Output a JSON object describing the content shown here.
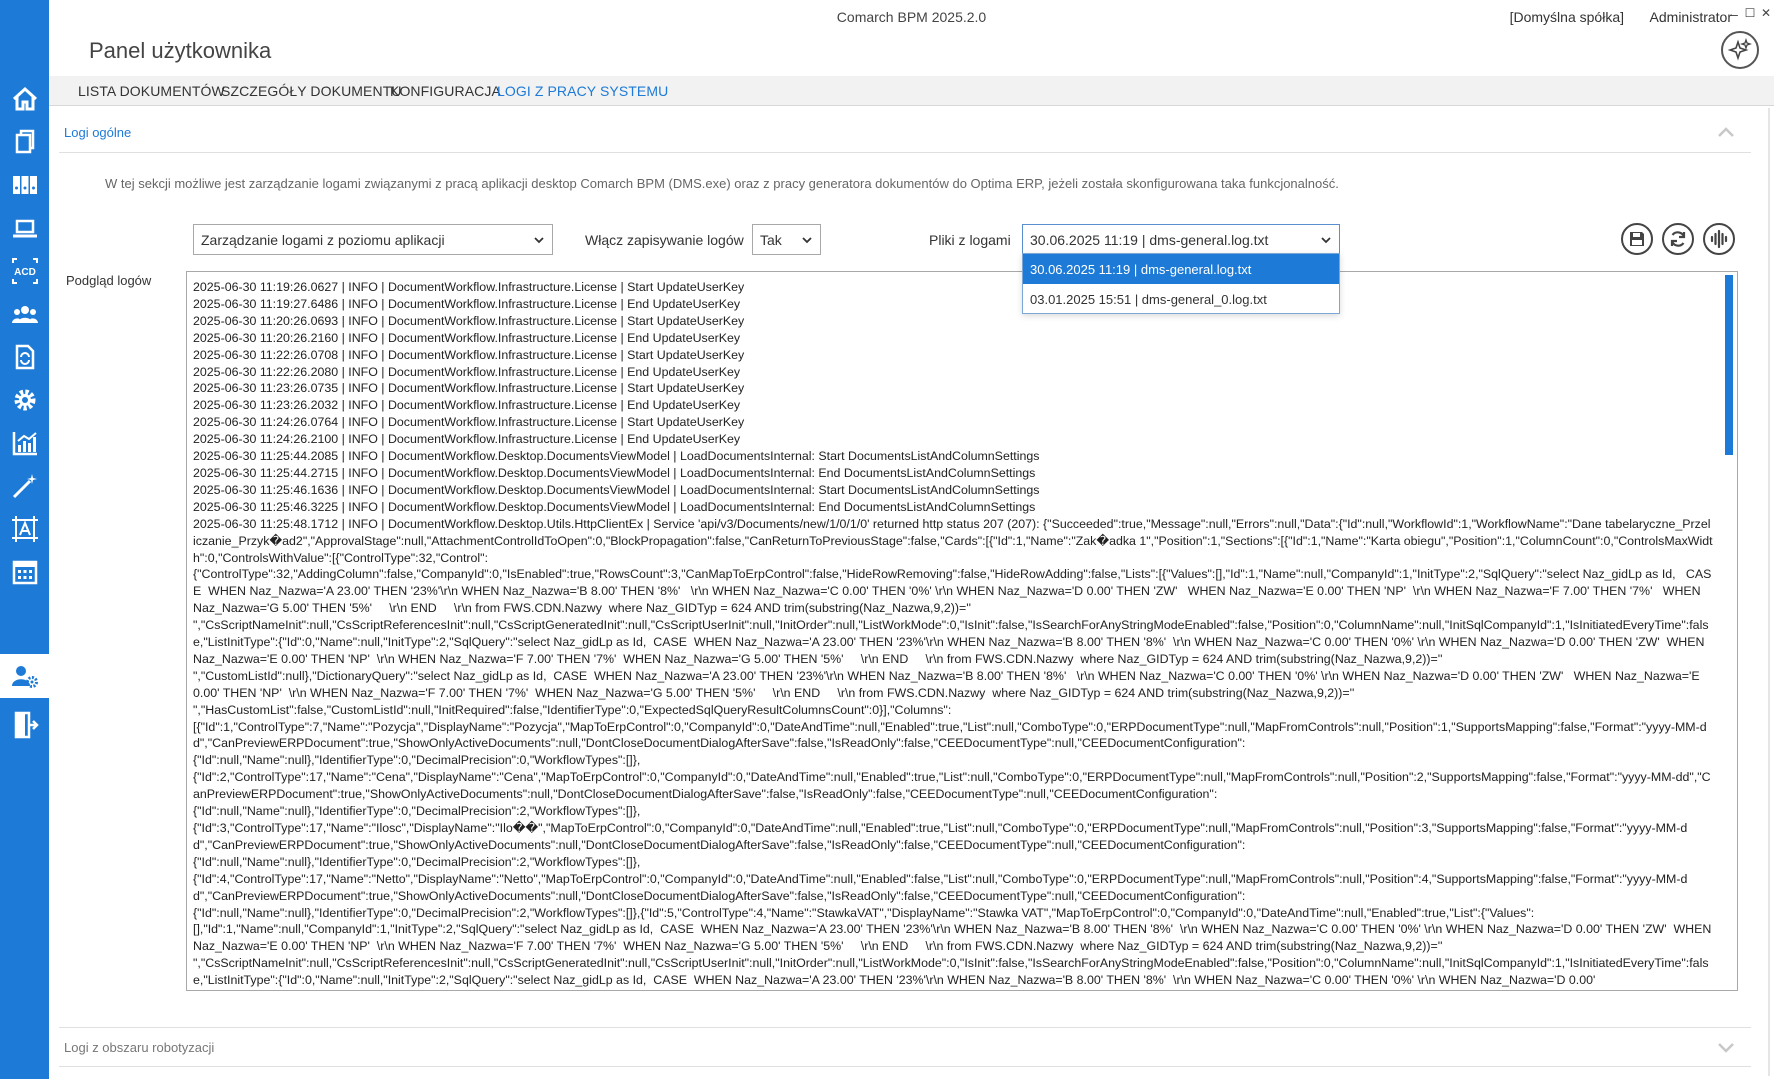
{
  "app": {
    "title": "Comarch BPM 2025.2.0",
    "company": "[Domyślna spółka]",
    "user": "Administrator",
    "page_title": "Panel użytkownika",
    "window_controls": {
      "minimize": "–",
      "maximize": "☐",
      "close": "✕"
    }
  },
  "rail": {
    "items": [
      {
        "icon": "home-icon"
      },
      {
        "icon": "documents-icon"
      },
      {
        "icon": "binders-icon"
      },
      {
        "icon": "laptop-icon"
      },
      {
        "icon": "acd-icon",
        "label": "ACD"
      },
      {
        "icon": "users-icon"
      },
      {
        "icon": "document-sync-icon"
      },
      {
        "icon": "gear-icon"
      },
      {
        "icon": "chart-icon"
      },
      {
        "icon": "magic-wand-icon"
      },
      {
        "icon": "text-frame-icon"
      },
      {
        "icon": "calendar-icon"
      },
      {
        "icon": "user-settings-icon",
        "active": true
      },
      {
        "icon": "logout-icon"
      }
    ]
  },
  "tabs": [
    {
      "label": "LISTA DOKUMENTÓW"
    },
    {
      "label": "SZCZEGÓŁY DOKUMENTU"
    },
    {
      "label": "KONFIGURACJA"
    },
    {
      "label": "LOGI Z PRACY SYSTEMU",
      "active": true
    }
  ],
  "general_logs": {
    "header": "Logi ogólne",
    "description": "W tej sekcji możliwe jest zarządzanie logami związanymi z pracą aplikacji desktop Comarch BPM (DMS.exe) oraz z pracy generatora dokumentów do Optima ERP, jeżeli została skonfigurowana taka funkcjonalność.",
    "mode_select": "Zarządzanie logami z poziomu aplikacji",
    "enable_label": "Włącz zapisywanie logów",
    "enable_value": "Tak",
    "files_label": "Pliki z logami",
    "files_value": "30.06.2025 11:19 | dms-general.log.txt",
    "files_options": [
      "30.06.2025 11:19 | dms-general.log.txt",
      "03.01.2025 15:51 | dms-general_0.log.txt"
    ],
    "preview_label": "Podgląd logów",
    "log_lines": [
      "2025-06-30 11:19:26.0627 | INFO | DocumentWorkflow.Infrastructure.License | Start UpdateUserKey",
      "2025-06-30 11:19:27.6486 | INFO | DocumentWorkflow.Infrastructure.License | End UpdateUserKey",
      "2025-06-30 11:20:26.0693 | INFO | DocumentWorkflow.Infrastructure.License | Start UpdateUserKey",
      "2025-06-30 11:20:26.2160 | INFO | DocumentWorkflow.Infrastructure.License | End UpdateUserKey",
      "2025-06-30 11:22:26.0708 | INFO | DocumentWorkflow.Infrastructure.License | Start UpdateUserKey",
      "2025-06-30 11:22:26.2080 | INFO | DocumentWorkflow.Infrastructure.License | End UpdateUserKey",
      "2025-06-30 11:23:26.0735 | INFO | DocumentWorkflow.Infrastructure.License | Start UpdateUserKey",
      "2025-06-30 11:23:26.2032 | INFO | DocumentWorkflow.Infrastructure.License | End UpdateUserKey",
      "2025-06-30 11:24:26.0764 | INFO | DocumentWorkflow.Infrastructure.License | Start UpdateUserKey",
      "2025-06-30 11:24:26.2100 | INFO | DocumentWorkflow.Infrastructure.License | End UpdateUserKey",
      "2025-06-30 11:25:44.2085 | INFO | DocumentWorkflow.Desktop.DocumentsViewModel | LoadDocumentsInternal: Start DocumentsListAndColumnSettings",
      "2025-06-30 11:25:44.2715 | INFO | DocumentWorkflow.Desktop.DocumentsViewModel | LoadDocumentsInternal: End DocumentsListAndColumnSettings",
      "2025-06-30 11:25:46.1636 | INFO | DocumentWorkflow.Desktop.DocumentsViewModel | LoadDocumentsInternal: Start DocumentsListAndColumnSettings",
      "2025-06-30 11:25:46.3225 | INFO | DocumentWorkflow.Desktop.DocumentsViewModel | LoadDocumentsInternal: End DocumentsListAndColumnSettings",
      "2025-06-30 11:25:48.1712 | INFO | DocumentWorkflow.Desktop.Utils.HttpClientEx | Service 'api/v3/Documents/new/1/0/1/0' returned http status 207 (207): {\"Succeeded\":true,\"Message\":null,\"Errors\":null,\"Data\":{\"Id\":null,\"WorkflowId\":1,\"WorkflowName\":\"Dane tabelaryczne_Przeliczanie_Przyk�ad2\",\"ApprovalStage\":null,\"AttachmentControlIdToOpen\":0,\"BlockPropagation\":false,\"CanReturnToPreviousStage\":false,\"Cards\":[{\"Id\":1,\"Name\":\"Zak�adka 1\",\"Position\":1,\"Sections\":[{\"Id\":1,\"Name\":\"Karta obiegu\",\"Position\":1,\"ColumnCount\":0,\"ControlsMaxWidth\":0,\"ControlsWithValue\":[{\"ControlType\":32,\"Control\":",
      "{\"ControlType\":32,\"AddingColumn\":false,\"CompanyId\":0,\"IsEnabled\":true,\"RowsCount\":3,\"CanMapToErpControl\":false,\"HideRowRemoving\":false,\"HideRowAdding\":false,\"Lists\":[{\"Values\":[],\"Id\":1,\"Name\":null,\"CompanyId\":1,\"InitType\":2,\"SqlQuery\":\"select Naz_gidLp as Id,   CASE  WHEN Naz_Nazwa='A 23.00' THEN '23%'\\r\\n WHEN Naz_Nazwa='B 8.00' THEN '8%'   \\r\\n WHEN Naz_Nazwa='C 0.00' THEN '0%' \\r\\n WHEN Naz_Nazwa='D 0.00' THEN 'ZW'   WHEN Naz_Nazwa='E 0.00' THEN 'NP'  \\r\\n WHEN Naz_Nazwa='F 7.00' THEN '7%'   WHEN Naz_Nazwa='G 5.00' THEN '5%'     \\r\\n END     \\r\\n from FWS.CDN.Nazwy  where Naz_GIDTyp = 624 AND trim(substring(Naz_Nazwa,9,2))=''",
      "\",\"CsScriptNameInit\":null,\"CsScriptReferencesInit\":null,\"CsScriptGeneratedInit\":null,\"CsScriptUserInit\":null,\"InitOrder\":null,\"ListWorkMode\":0,\"IsInit\":false,\"IsSearchForAnyStringModeEnabled\":false,\"Position\":0,\"ColumnName\":null,\"InitSqlCompanyId\":1,\"IsInitiatedEveryTime\":false,\"ListInitType\":{\"Id\":0,\"Name\":null,\"InitType\":2,\"SqlQuery\":\"select Naz_gidLp as Id,  CASE  WHEN Naz_Nazwa='A 23.00' THEN '23%'\\r\\n WHEN Naz_Nazwa='B 8.00' THEN '8%'  \\r\\n WHEN Naz_Nazwa='C 0.00' THEN '0%' \\r\\n WHEN Naz_Nazwa='D 0.00' THEN 'ZW'  WHEN Naz_Nazwa='E 0.00' THEN 'NP'  \\r\\n WHEN Naz_Nazwa='F 7.00' THEN '7%'  WHEN Naz_Nazwa='G 5.00' THEN '5%'     \\r\\n END     \\r\\n from FWS.CDN.Nazwy  where Naz_GIDTyp = 624 AND trim(substring(Naz_Nazwa,9,2))=''",
      "\",\"CustomListId\":null},\"DictionaryQuery\":\"select Naz_gidLp as Id,  CASE  WHEN Naz_Nazwa='A 23.00' THEN '23%'\\r\\n WHEN Naz_Nazwa='B 8.00' THEN '8%'   \\r\\n WHEN Naz_Nazwa='C 0.00' THEN '0%' \\r\\n WHEN Naz_Nazwa='D 0.00' THEN 'ZW'   WHEN Naz_Nazwa='E 0.00' THEN 'NP'  \\r\\n WHEN Naz_Nazwa='F 7.00' THEN '7%'  WHEN Naz_Nazwa='G 5.00' THEN '5%'     \\r\\n END     \\r\\n from FWS.CDN.Nazwy  where Naz_GIDTyp = 624 AND trim(substring(Naz_Nazwa,9,2))=''",
      "\",\"HasCustomList\":false,\"CustomListId\":null,\"InitRequired\":false,\"IdentifierType\":0,\"ExpectedSqlQueryResultColumnsCount\":0}],\"Columns\":",
      "[{\"Id\":1,\"ControlType\":7,\"Name\":\"Pozycja\",\"DisplayName\":\"Pozycja\",\"MapToErpControl\":0,\"CompanyId\":0,\"DateAndTime\":null,\"Enabled\":true,\"List\":null,\"ComboType\":0,\"ERPDocumentType\":null,\"MapFromControls\":null,\"Position\":1,\"SupportsMapping\":false,\"Format\":\"yyyy-MM-dd\",\"CanPreviewERPDocument\":true,\"ShowOnlyActiveDocuments\":null,\"DontCloseDocumentDialogAfterSave\":false,\"IsReadOnly\":false,\"CEEDocumentType\":null,\"CEEDocumentConfiguration\":",
      "{\"Id\":null,\"Name\":null},\"IdentifierType\":0,\"DecimalPrecision\":0,\"WorkflowTypes\":[]},",
      "{\"Id\":2,\"ControlType\":17,\"Name\":\"Cena\",\"DisplayName\":\"Cena\",\"MapToErpControl\":0,\"CompanyId\":0,\"DateAndTime\":null,\"Enabled\":true,\"List\":null,\"ComboType\":0,\"ERPDocumentType\":null,\"MapFromControls\":null,\"Position\":2,\"SupportsMapping\":false,\"Format\":\"yyyy-MM-dd\",\"CanPreviewERPDocument\":true,\"ShowOnlyActiveDocuments\":null,\"DontCloseDocumentDialogAfterSave\":false,\"IsReadOnly\":false,\"CEEDocumentType\":null,\"CEEDocumentConfiguration\":",
      "{\"Id\":null,\"Name\":null},\"IdentifierType\":0,\"DecimalPrecision\":2,\"WorkflowTypes\":[]},",
      "{\"Id\":3,\"ControlType\":17,\"Name\":\"Ilosc\",\"DisplayName\":\"Ilo��\",\"MapToErpControl\":0,\"CompanyId\":0,\"DateAndTime\":null,\"Enabled\":true,\"List\":null,\"ComboType\":0,\"ERPDocumentType\":null,\"MapFromControls\":null,\"Position\":3,\"SupportsMapping\":false,\"Format\":\"yyyy-MM-dd\",\"CanPreviewERPDocument\":true,\"ShowOnlyActiveDocuments\":null,\"DontCloseDocumentDialogAfterSave\":false,\"IsReadOnly\":false,\"CEEDocumentType\":null,\"CEEDocumentConfiguration\":",
      "{\"Id\":null,\"Name\":null},\"IdentifierType\":0,\"DecimalPrecision\":2,\"WorkflowTypes\":[]},",
      "{\"Id\":4,\"ControlType\":17,\"Name\":\"Netto\",\"DisplayName\":\"Netto\",\"MapToErpControl\":0,\"CompanyId\":0,\"DateAndTime\":null,\"Enabled\":false,\"List\":null,\"ComboType\":0,\"ERPDocumentType\":null,\"MapFromControls\":null,\"Position\":4,\"SupportsMapping\":false,\"Format\":\"yyyy-MM-dd\",\"CanPreviewERPDocument\":true,\"ShowOnlyActiveDocuments\":null,\"DontCloseDocumentDialogAfterSave\":false,\"IsReadOnly\":false,\"CEEDocumentType\":null,\"CEEDocumentConfiguration\":",
      "{\"Id\":null,\"Name\":null},\"IdentifierType\":0,\"DecimalPrecision\":2,\"WorkflowTypes\":[]},{\"Id\":5,\"ControlType\":4,\"Name\":\"StawkaVAT\",\"DisplayName\":\"Stawka VAT\",\"MapToErpControl\":0,\"CompanyId\":0,\"DateAndTime\":null,\"Enabled\":true,\"List\":{\"Values\":",
      "[],\"Id\":1,\"Name\":null,\"CompanyId\":1,\"InitType\":2,\"SqlQuery\":\"select Naz_gidLp as Id,  CASE  WHEN Naz_Nazwa='A 23.00' THEN '23%'\\r\\n WHEN Naz_Nazwa='B 8.00' THEN '8%'  \\r\\n WHEN Naz_Nazwa='C 0.00' THEN '0%' \\r\\n WHEN Naz_Nazwa='D 0.00' THEN 'ZW'  WHEN Naz_Nazwa='E 0.00' THEN 'NP'  \\r\\n WHEN Naz_Nazwa='F 7.00' THEN '7%'  WHEN Naz_Nazwa='G 5.00' THEN '5%'     \\r\\n END     \\r\\n from FWS.CDN.Nazwy  where Naz_GIDTyp = 624 AND trim(substring(Naz_Nazwa,9,2))=''",
      "\",\"CsScriptNameInit\":null,\"CsScriptReferencesInit\":null,\"CsScriptGeneratedInit\":null,\"CsScriptUserInit\":null,\"InitOrder\":null,\"ListWorkMode\":0,\"IsInit\":false,\"IsSearchForAnyStringModeEnabled\":false,\"Position\":0,\"ColumnName\":null,\"InitSqlCompanyId\":1,\"IsInitiatedEveryTime\":false,\"ListInitType\":{\"Id\":0,\"Name\":null,\"InitType\":2,\"SqlQuery\":\"select Naz_gidLp as Id,  CASE  WHEN Naz_Nazwa='A 23.00' THEN '23%'\\r\\n WHEN Naz_Nazwa='B 8.00' THEN '8%'  \\r\\n WHEN Naz_Nazwa='C 0.00' THEN '0%' \\r\\n WHEN Naz_Nazwa='D 0.00'"
    ]
  },
  "robot_logs": {
    "header": "Logi z obszaru robotyzacji"
  },
  "colors": {
    "accent": "#1d7ad6",
    "rail_bg": "#1d7ad6",
    "tab_bar_bg": "#f2f2f2"
  }
}
